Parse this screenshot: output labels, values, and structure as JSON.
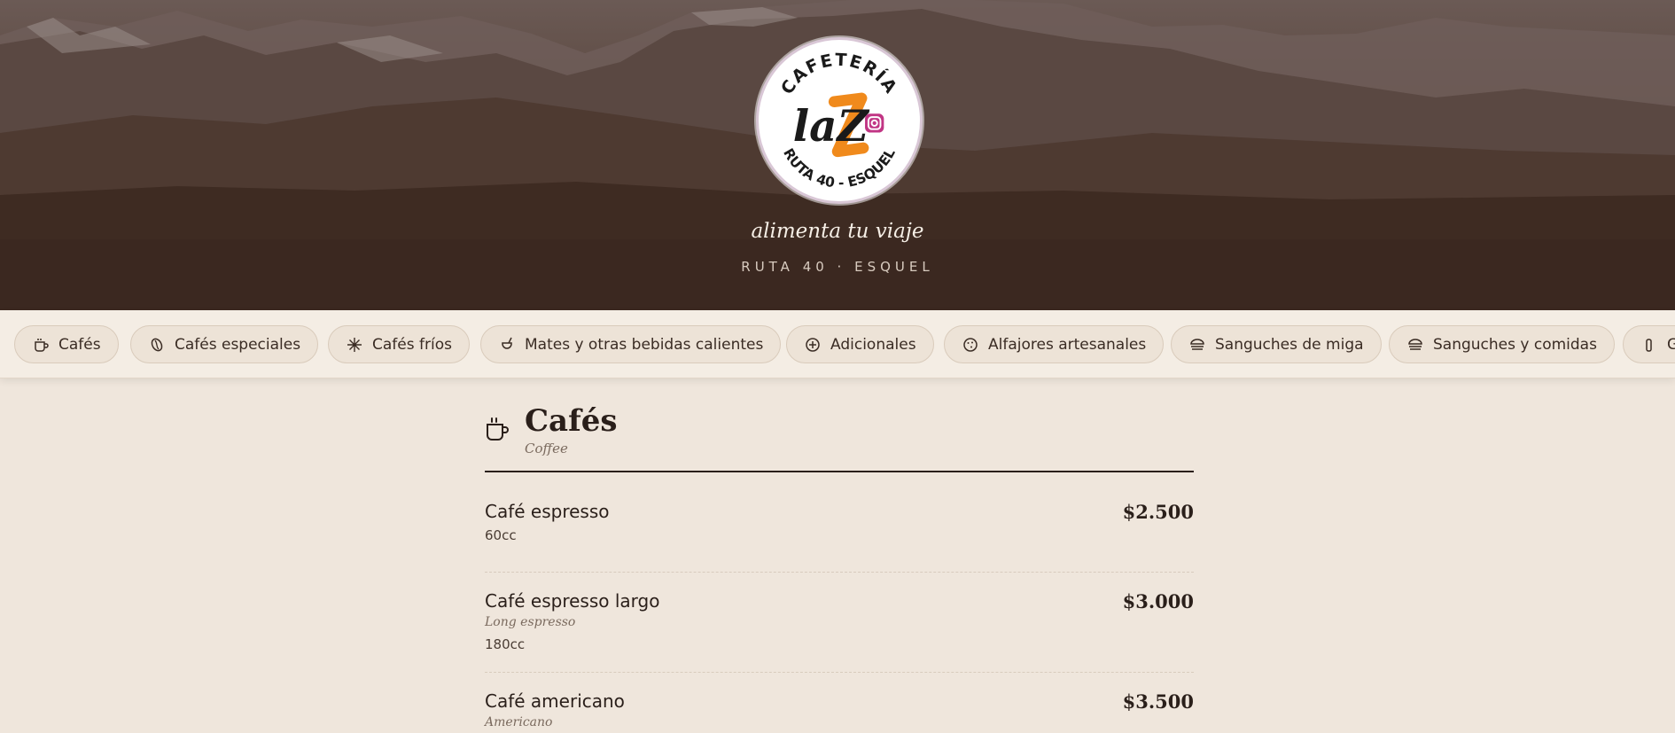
{
  "hero": {
    "logo": {
      "top_text": "CAFETERÍA",
      "mark": "laZ",
      "bottom_text": "RUTA 40 - ESQUEL"
    },
    "tagline": "alimenta tu viaje",
    "subline": "RUTA 40 · ESQUEL"
  },
  "categories": [
    {
      "label": "Cafés",
      "icon": "cup-icon"
    },
    {
      "label": "Cafés especiales",
      "icon": "bean-icon"
    },
    {
      "label": "Cafés fríos",
      "icon": "snowflake-icon"
    },
    {
      "label": "Mates y otras bebidas calientes",
      "icon": "mate-icon"
    },
    {
      "label": "Adicionales",
      "icon": "plus-circle-icon"
    },
    {
      "label": "Alfajores artesanales",
      "icon": "cookie-icon"
    },
    {
      "label": "Sanguches de miga",
      "icon": "sandwich-icon"
    },
    {
      "label": "Sanguches y comidas",
      "icon": "sandwich-icon"
    },
    {
      "label": "G",
      "icon": "bottle-icon"
    }
  ],
  "section": {
    "title": "Cafés",
    "subtitle": "Coffee",
    "icon": "cup-icon",
    "items": [
      {
        "name": "Café espresso",
        "english": "",
        "desc": "60cc",
        "price": "$2.500"
      },
      {
        "name": "Café espresso largo",
        "english": "Long espresso",
        "desc": "180cc",
        "price": "$3.000"
      },
      {
        "name": "Café americano",
        "english": "Americano",
        "desc": "",
        "price": "$3.500"
      }
    ]
  },
  "colors": {
    "accent_orange": "#f08a1c",
    "text_dark": "#2a1f1a",
    "background": "#efe6dc"
  }
}
